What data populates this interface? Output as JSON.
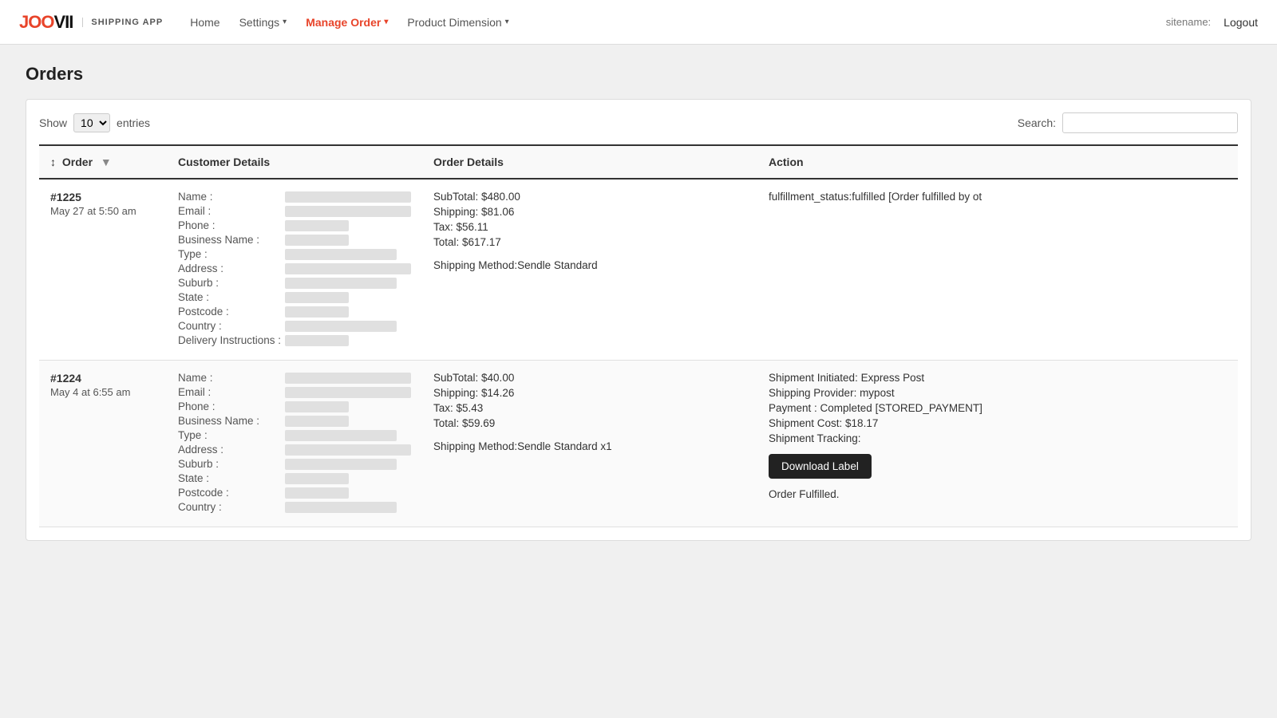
{
  "navbar": {
    "brand": "JOOVII",
    "brand_span": "I",
    "subtitle": "SHIPPING APP",
    "nav_items": [
      {
        "label": "Home",
        "active": false,
        "has_dropdown": false
      },
      {
        "label": "Settings",
        "active": false,
        "has_dropdown": true
      },
      {
        "label": "Manage Order",
        "active": true,
        "has_dropdown": true
      },
      {
        "label": "Product Dimension",
        "active": false,
        "has_dropdown": true
      }
    ],
    "sitename_label": "sitename:",
    "logout_label": "Logout"
  },
  "page": {
    "title": "Orders"
  },
  "controls": {
    "show_label": "Show",
    "entries_label": "entries",
    "show_value": "10",
    "search_label": "Search:",
    "search_placeholder": ""
  },
  "table": {
    "headers": {
      "order": "Order",
      "customer_details": "Customer Details",
      "order_details": "Order Details",
      "action": "Action"
    },
    "rows": [
      {
        "order_num": "#1225",
        "order_date": "May 27 at 5:50 am",
        "customer_fields": [
          "Name :",
          "Email :",
          "Phone :",
          "Business Name :",
          "Type :",
          "Address :",
          "Suburb :",
          "State :",
          "Postcode :",
          "Country :",
          "Delivery Instructions :"
        ],
        "order_details": {
          "subtotal": "SubTotal: $480.00",
          "shipping": "Shipping: $81.06",
          "tax": "Tax: $56.11",
          "total": "Total: $617.17",
          "shipping_method": "Shipping Method:Sendle Standard"
        },
        "action": {
          "status_text": "fulfillment_status:fulfilled [Order fulfilled by ot",
          "has_download_button": false,
          "download_label": "",
          "fulfilled_text": ""
        }
      },
      {
        "order_num": "#1224",
        "order_date": "May 4 at 6:55 am",
        "customer_fields": [
          "Name :",
          "Email :",
          "Phone :",
          "Business Name :",
          "Type :",
          "Address :",
          "Suburb :",
          "State :",
          "Postcode :",
          "Country :"
        ],
        "order_details": {
          "subtotal": "SubTotal: $40.00",
          "shipping": "Shipping: $14.26",
          "tax": "Tax: $5.43",
          "total": "Total: $59.69",
          "shipping_method": "Shipping Method:Sendle Standard x1"
        },
        "action": {
          "shipment_initiated": "Shipment Initiated: Express Post",
          "shipping_provider": "Shipping Provider: mypost",
          "payment": "Payment : Completed [STORED_PAYMENT]",
          "shipment_cost": "Shipment Cost: $18.17",
          "shipment_tracking": "Shipment Tracking:",
          "has_download_button": true,
          "download_label": "Download Label",
          "fulfilled_text": "Order Fulfilled."
        }
      }
    ]
  }
}
